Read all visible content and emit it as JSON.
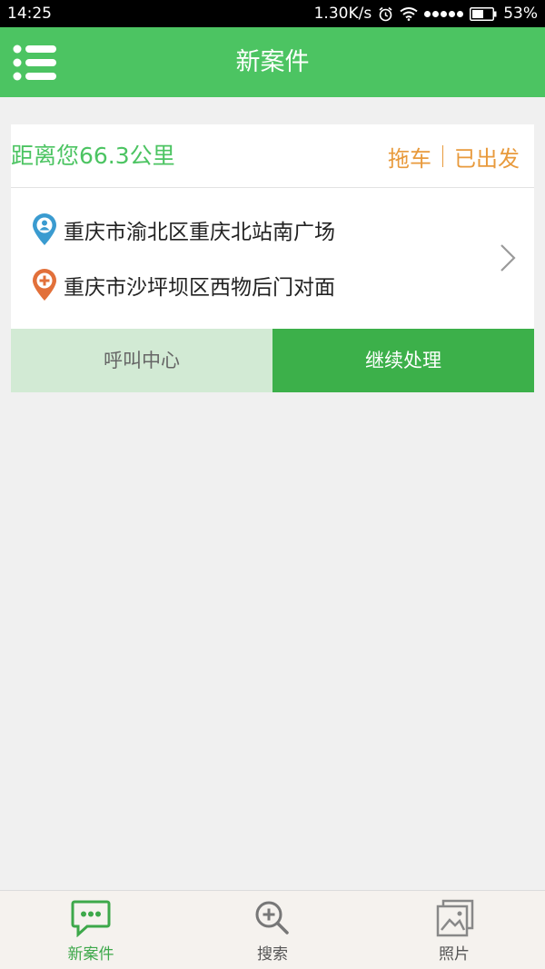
{
  "statusbar": {
    "time": "14:25",
    "speed": "1.30K/s",
    "battery": "53%"
  },
  "header": {
    "title": "新案件"
  },
  "case": {
    "distance": "距离您66.3公里",
    "tag_tow": "拖车",
    "tag_status": "已出发",
    "origin": "重庆市渝北区重庆北站南广场",
    "destination": "重庆市沙坪坝区西物后门对面",
    "call_center_label": "呼叫中心",
    "continue_label": "继续处理"
  },
  "tabs": [
    {
      "label": "新案件",
      "icon": "chat-bubble-icon",
      "active": true
    },
    {
      "label": "搜索",
      "icon": "search-plus-icon",
      "active": false
    },
    {
      "label": "照片",
      "icon": "picture-icon",
      "active": false
    }
  ],
  "colors": {
    "primary": "#4cc462",
    "primary_dark": "#3cb04a",
    "accent": "#e89a3c",
    "origin_pin": "#3a9bd0",
    "destination_pin": "#e2703a",
    "background": "#f0f0f0"
  }
}
